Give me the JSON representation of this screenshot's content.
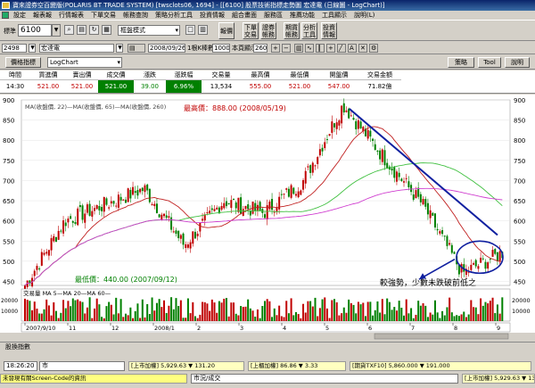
{
  "window": {
    "title": "寶來證券空百變版(POLARIS BT TRADE SYSTEM)  [twsclots06, 1694] - [[6100] 股票技術指標走勢圖  宏達電 (日線圖 - LogChart)]"
  },
  "menu": [
    "設定",
    "報表報",
    "行情報表",
    "下單交易",
    "帳務查詢",
    "策略分析工具",
    "投資情報",
    "組合畫面",
    "服務區",
    "推薦功能",
    "工具顯示",
    "說明(L)"
  ],
  "toolbar1": {
    "code_label": "標準",
    "stock_code": "6100",
    "mode": "框盤模式",
    "buttons": [
      "報價",
      "下單\n交易",
      "證券\n帳務",
      "期貨\n帳務",
      "分析\n工具",
      "投資\n情報"
    ]
  },
  "toolbar2": {
    "code": "2498",
    "name": "宏達電",
    "date": "2008/09/26",
    "kline_label": "1根K棒數目",
    "kline_count": "1000",
    "display_label": "本頁顯示",
    "display_count": "260"
  },
  "toolbar3": {
    "indicator_button": "價格指標",
    "chart_select": "LogChart",
    "right_buttons": [
      "策略",
      "Tool",
      "說明"
    ]
  },
  "quote": {
    "headers": [
      "時間",
      "買進價",
      "賣出價",
      "成交價",
      "漲跌",
      "漲跌幅",
      "交易量",
      "最高價",
      "最低價",
      "開盤價",
      "交易金額"
    ],
    "values": [
      "14:30",
      "521.00",
      "521.00",
      "521.00",
      "39.00",
      "6.96%",
      "13,534",
      "555.00",
      "521.00",
      "547.00",
      "71.82億"
    ]
  },
  "chart": {
    "ma_caption": "MA(收盤價, 22)—MA(收盤價, 65)—MA(收盤價, 260)",
    "high_label": "最高價：888.00 (2008/05/19)",
    "low_label": "最低價：440.00 (2007/09/12)",
    "annotation_line1": "較強勢，少數未跌破前低之",
    "annotation_line2": "股票，但是否會進行補跌?",
    "volume_caption": "交易量 MA  5—MA 20—MA 60—",
    "price_ticks": [
      "900",
      "850",
      "800",
      "750",
      "700",
      "650",
      "600",
      "550",
      "500",
      "450"
    ],
    "volume_ticks": [
      "20000",
      "10000"
    ],
    "date_ticks": [
      "2007/9/10",
      "11",
      "12",
      "2008/1",
      "2",
      "3",
      "4",
      "5",
      "6",
      "7",
      "8",
      "9"
    ]
  },
  "chart_data": {
    "type": "line",
    "title": "",
    "xlabel": "",
    "ylabel": "",
    "ylim": [
      440,
      900
    ],
    "x": [
      "2007/09/12",
      "2007/10",
      "2007/11",
      "2007/12",
      "2008/01",
      "2008/02",
      "2008/03",
      "2008/04",
      "2008/05/19",
      "2008/06",
      "2008/07",
      "2008/08",
      "2008/09/26"
    ],
    "series": [
      {
        "values": [
          440,
          600,
          640,
          680,
          540,
          650,
          620,
          700,
          888,
          760,
          640,
          470,
          521
        ]
      }
    ]
  },
  "status": {
    "tab": "股換指數",
    "time": "18:26:20",
    "market": "市",
    "tse": "[上市加權] 5,929.63 ▼ 131.20",
    "otc": "[上櫃加權] 86.86 ▼ 3.33",
    "futures": "[期貨TXF10] 5,860.000 ▼ 191.000",
    "message": "未發現有關Screen-Code的資訊",
    "market2": "市況/成交",
    "tse2": "[上市加權] 5,929.63 ▼ 131.20"
  },
  "colors": {
    "up": "#c00000",
    "down": "#008000",
    "trendline": "#1020a0",
    "ma22": "#c02020",
    "ma65": "#40c040",
    "ma260": "#d040d0"
  }
}
